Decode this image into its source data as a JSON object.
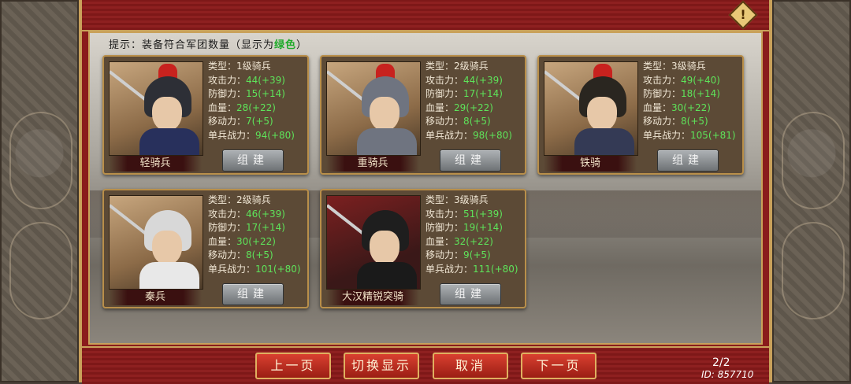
{
  "hint": {
    "prefix": "提示：装备符合军团数量（显示为",
    "green_word": "绿色",
    "suffix": "）"
  },
  "stat_labels": {
    "type": "类型：",
    "attack": "攻击力：",
    "defense": "防御力：",
    "hp": "血量：",
    "move": "移动力：",
    "power": "单兵战力："
  },
  "units": [
    {
      "name": "轻骑兵",
      "type": "1级骑兵",
      "attack": "44(+39)",
      "defense": "15(+14)",
      "hp": "28(+22)",
      "move": "7(+5)",
      "power": "94(+80)",
      "build": "组建"
    },
    {
      "name": "重骑兵",
      "type": "2级骑兵",
      "attack": "44(+39)",
      "defense": "17(+14)",
      "hp": "29(+22)",
      "move": "8(+5)",
      "power": "98(+80)",
      "build": "组建"
    },
    {
      "name": "铁骑",
      "type": "3级骑兵",
      "attack": "49(+40)",
      "defense": "18(+14)",
      "hp": "30(+22)",
      "move": "8(+5)",
      "power": "105(+81)",
      "build": "组建"
    },
    {
      "name": "秦兵",
      "type": "2级骑兵",
      "attack": "46(+39)",
      "defense": "17(+14)",
      "hp": "30(+22)",
      "move": "8(+5)",
      "power": "101(+80)",
      "build": "组建"
    },
    {
      "name": "大汉精锐突骑",
      "type": "3级骑兵",
      "attack": "51(+39)",
      "defense": "19(+14)",
      "hp": "32(+22)",
      "move": "9(+5)",
      "power": "111(+80)",
      "build": "组建"
    }
  ],
  "nav": {
    "prev": "上一页",
    "toggle": "切换显示",
    "cancel": "取消",
    "next": "下一页"
  },
  "page_indicator": "2/2",
  "id_label": "ID: 857710",
  "icons": {
    "alert": "exclamation-diamond-icon"
  },
  "colors": {
    "frame_red": "#8a1c1c",
    "gold": "#c9a15a",
    "stat_green": "#5ee35a"
  }
}
